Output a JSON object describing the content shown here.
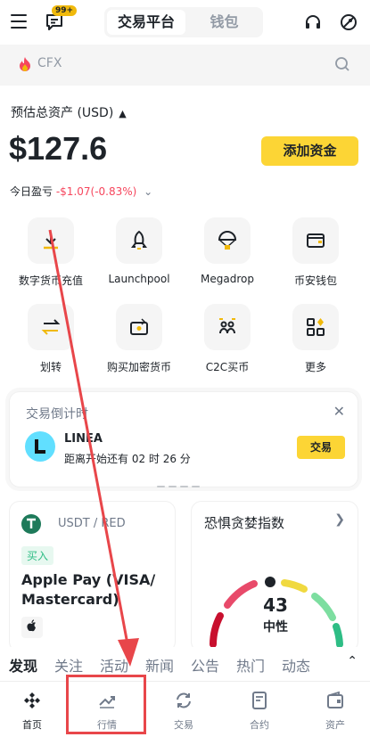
{
  "header": {
    "badge": "99+",
    "tabs": [
      {
        "label": "交易平台"
      },
      {
        "label": "钱包"
      }
    ]
  },
  "search": {
    "placeholder": "CFX"
  },
  "assets": {
    "label": "预估总资产 (USD)",
    "balance": "$127.6",
    "add_funds": "添加资金",
    "pnl_label": "今日盈亏",
    "pnl_value": "-$1.07(-0.83%)"
  },
  "shortcuts": [
    {
      "label": "数字货币充值",
      "icon": "deposit-icon"
    },
    {
      "label": "Launchpool",
      "icon": "rocket-icon"
    },
    {
      "label": "Megadrop",
      "icon": "parachute-icon"
    },
    {
      "label": "币安钱包",
      "icon": "wallet-icon"
    },
    {
      "label": "划转",
      "icon": "transfer-icon"
    },
    {
      "label": "购买加密货币",
      "icon": "buy-crypto-icon"
    },
    {
      "label": "C2C买币",
      "icon": "c2c-icon"
    },
    {
      "label": "更多",
      "icon": "more-icon"
    }
  ],
  "countdown": {
    "title": "交易倒计时",
    "token": "LINEA",
    "time_text": "距离开始还有 02 时 26 分",
    "trade_label": "交易"
  },
  "p2p_card": {
    "pair": "USDT / RED",
    "tag": "买入",
    "method": "Apple Pay (VISA/ Mastercard)"
  },
  "fear_greed": {
    "title": "恐惧贪婪指数",
    "value": 43,
    "label": "中性"
  },
  "news_tabs": [
    {
      "label": "发现"
    },
    {
      "label": "关注"
    },
    {
      "label": "活动"
    },
    {
      "label": "新闻"
    },
    {
      "label": "公告"
    },
    {
      "label": "热门"
    },
    {
      "label": "动态"
    }
  ],
  "bottom_nav": [
    {
      "label": "首页"
    },
    {
      "label": "行情"
    },
    {
      "label": "交易"
    },
    {
      "label": "合约"
    },
    {
      "label": "资产"
    }
  ],
  "colors": {
    "brand_yellow": "#fcd535",
    "negative": "#f6465d",
    "positive": "#2ebd85",
    "annotation": "#e8464a"
  }
}
